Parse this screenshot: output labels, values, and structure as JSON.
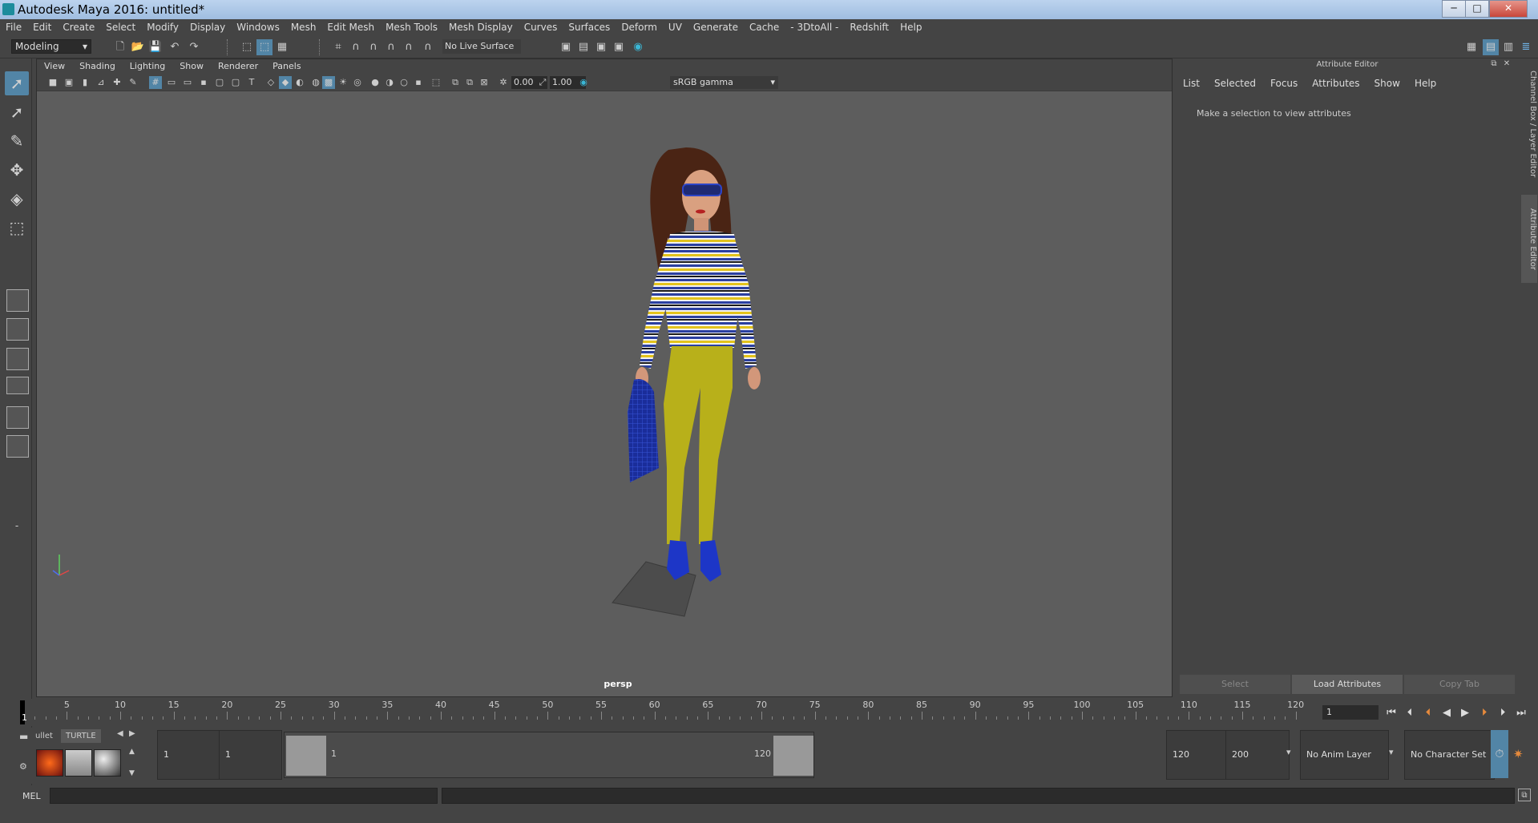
{
  "window": {
    "title": "Autodesk Maya 2016: untitled*",
    "min": "─",
    "max": "□",
    "close": "✕"
  },
  "menubar": [
    "File",
    "Edit",
    "Create",
    "Select",
    "Modify",
    "Display",
    "Windows",
    "Mesh",
    "Edit Mesh",
    "Mesh Tools",
    "Mesh Display",
    "Curves",
    "Surfaces",
    "Deform",
    "UV",
    "Generate",
    "Cache",
    "- 3DtoAll -",
    "Redshift",
    "Help"
  ],
  "statusline": {
    "mode": "Modeling",
    "live_surface": "No Live Surface"
  },
  "viewport": {
    "menu": [
      "View",
      "Shading",
      "Lighting",
      "Show",
      "Renderer",
      "Panels"
    ],
    "exposure": "0.00",
    "gamma": "1.00",
    "color_management": "sRGB gamma",
    "camera_label": "persp",
    "colors": {
      "background": "#5d5d5d",
      "shirt_blue": "#2a3fa0",
      "shirt_yellow": "#e3c31c",
      "pants": "#b8b01a",
      "shoes": "#1d36c7",
      "bag": "#1a2d9a",
      "hair": "#4a2414"
    }
  },
  "attribute_editor": {
    "title": "Attribute Editor",
    "menu": [
      "List",
      "Selected",
      "Focus",
      "Attributes",
      "Show",
      "Help"
    ],
    "message": "Make a selection to view attributes",
    "buttons": {
      "select": "Select",
      "load": "Load Attributes",
      "copy": "Copy Tab"
    }
  },
  "side_tabs": {
    "channel_box": "Channel Box / Layer Editor",
    "attribute_editor": "Attribute Editor"
  },
  "timeline": {
    "ticks": [
      "5",
      "10",
      "15",
      "20",
      "25",
      "30",
      "35",
      "40",
      "45",
      "50",
      "55",
      "60",
      "65",
      "70",
      "75",
      "80",
      "85",
      "90",
      "95",
      "100",
      "105",
      "110",
      "115",
      "120"
    ],
    "current_frame_label": "1",
    "current_frame": "1"
  },
  "range": {
    "start": "1",
    "playback_start": "1",
    "range_start_label": "1",
    "range_end_label": "120",
    "playback_end": "120",
    "end": "200",
    "anim_layer": "No Anim Layer",
    "character_set": "No Character Set"
  },
  "shelf": {
    "tab_partial": "ullet",
    "tab_turtle": "TURTLE"
  },
  "mel": {
    "label": "MEL"
  }
}
